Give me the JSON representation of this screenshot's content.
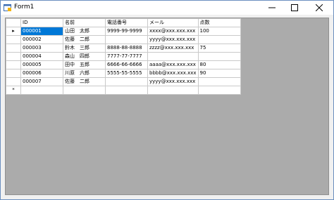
{
  "window": {
    "title": "Form1"
  },
  "grid": {
    "columns": [
      "ID",
      "名前",
      "電話番号",
      "メール",
      "点数"
    ],
    "current_row_marker": "▸",
    "new_row_marker": "*",
    "rows": [
      [
        "000001",
        "山田　太郎",
        "9999-99-9999",
        "xxxx@xxx.xxx.xxx",
        "100"
      ],
      [
        "000002",
        "佐藤　二郎",
        "",
        "yyyy@xxx.xxx.xxx",
        ""
      ],
      [
        "000003",
        "鈴木　三郎",
        "8888-88-8888",
        "zzzz@xxx.xxx.xxx",
        "75"
      ],
      [
        "000004",
        "森山　四郎",
        "7777-77-7777",
        "",
        ""
      ],
      [
        "000005",
        "田中　五郎",
        "6666-66-6666",
        "aaaa@xxx.xxx.xxx",
        "80"
      ],
      [
        "000006",
        "川原　六郎",
        "5555-55-5555",
        "bbbb@xxx.xxx.xxx",
        "90"
      ],
      [
        "000007",
        "佐藤　二郎",
        "",
        "yyyy@xxx.xxx.xxx",
        ""
      ]
    ]
  },
  "colors": {
    "selection": "#0078d7",
    "background": "#ababab"
  }
}
